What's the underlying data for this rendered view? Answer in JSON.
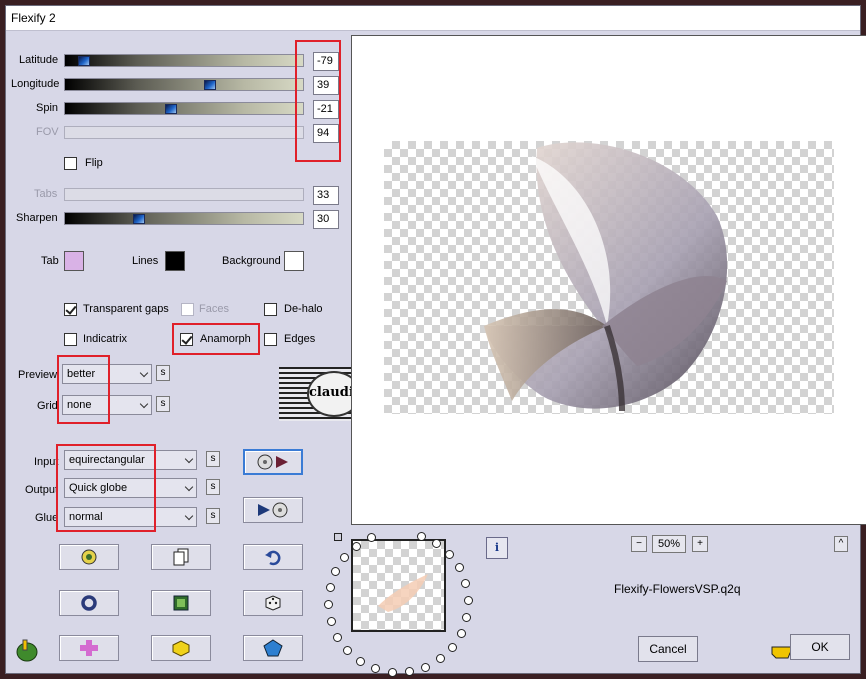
{
  "window": {
    "title": "Flexify 2"
  },
  "sliders": [
    {
      "id": "latitude",
      "label": "Latitude",
      "value": "-79",
      "fraction": 0.08,
      "enabled": true
    },
    {
      "id": "longitude",
      "label": "Longitude",
      "value": "39",
      "fraction": 0.61,
      "enabled": true
    },
    {
      "id": "spin",
      "label": "Spin",
      "value": "-21",
      "fraction": 0.44,
      "enabled": true
    },
    {
      "id": "fov",
      "label": "FOV",
      "value": "94",
      "fraction": null,
      "enabled": false
    }
  ],
  "flip": {
    "label": "Flip",
    "checked": false
  },
  "tabs_slider": {
    "label": "Tabs",
    "value": "33",
    "enabled": false
  },
  "sharpen_slider": {
    "label": "Sharpen",
    "value": "30",
    "fraction": 0.3
  },
  "colors": {
    "tab": {
      "label": "Tab",
      "hex": "#d9b2e6"
    },
    "lines": {
      "label": "Lines",
      "hex": "#000000"
    },
    "background": {
      "label": "Background",
      "hex": "#ffffff"
    }
  },
  "options": {
    "transparent_gaps": {
      "label": "Transparent gaps",
      "checked": true,
      "enabled": true
    },
    "faces": {
      "label": "Faces",
      "checked": false,
      "enabled": false
    },
    "de_halo": {
      "label": "De-halo",
      "checked": false,
      "enabled": true
    },
    "indicatrix": {
      "label": "Indicatrix",
      "checked": false,
      "enabled": true
    },
    "anamorph": {
      "label": "Anamorph",
      "checked": true,
      "enabled": true
    },
    "edges": {
      "label": "Edges",
      "checked": false,
      "enabled": true
    }
  },
  "preview_select": {
    "label": "Preview",
    "value": "better",
    "s_label": "s"
  },
  "grid_select": {
    "label": "Grid",
    "value": "none",
    "s_label": "s"
  },
  "input_select": {
    "label": "Input",
    "value": "equirectangular",
    "s_label": "s"
  },
  "output_select": {
    "label": "Output",
    "value": "Quick globe",
    "s_label": "s"
  },
  "glue_select": {
    "label": "Glue",
    "value": "normal",
    "s_label": "s"
  },
  "watermark": {
    "text": "claudia"
  },
  "zoom": {
    "value": "50%",
    "minus": "−",
    "plus": "+"
  },
  "info_icon": "i",
  "collapse_icon": "^",
  "filename": "Flexify-FlowersVSP.q2q",
  "buttons": {
    "cancel": "Cancel",
    "ok": "OK"
  },
  "icons": [
    "process-forward-icon",
    "process-back-icon",
    "globe-yellow-icon",
    "copy-pages-icon",
    "undo-arrow-icon",
    "ring-icon",
    "green-square-icon",
    "dice-icon",
    "pink-cross-icon",
    "yellow-cube-icon",
    "blue-pentagon-icon",
    "hand-logo-icon",
    "pointing-hand-icon"
  ]
}
